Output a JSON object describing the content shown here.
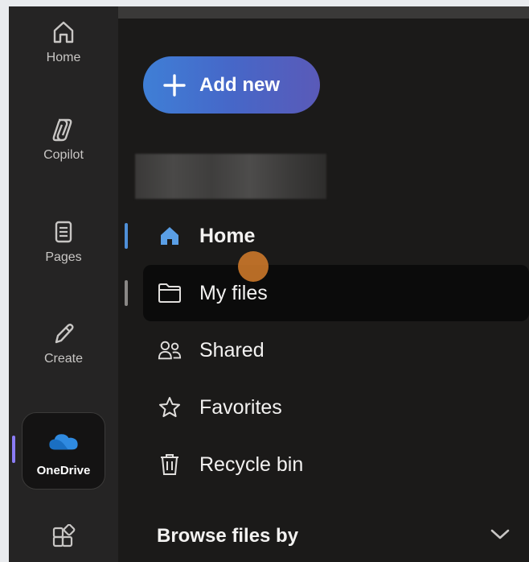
{
  "rail": {
    "items": [
      {
        "label": "Home",
        "icon": "home-icon"
      },
      {
        "label": "Copilot",
        "icon": "copilot-icon"
      },
      {
        "label": "Pages",
        "icon": "pages-icon"
      },
      {
        "label": "Create",
        "icon": "pen-icon"
      },
      {
        "label": "OneDrive",
        "icon": "onedrive-cloud-icon",
        "active": true
      },
      {
        "label": "",
        "icon": "apps-icon"
      }
    ]
  },
  "nav": {
    "add_new_label": "Add new",
    "items": [
      {
        "label": "Home",
        "icon": "home-filled-icon",
        "selected": true
      },
      {
        "label": "My files",
        "icon": "folder-icon",
        "hover": true
      },
      {
        "label": "Shared",
        "icon": "people-icon"
      },
      {
        "label": "Favorites",
        "icon": "star-icon"
      },
      {
        "label": "Recycle bin",
        "icon": "trash-icon"
      }
    ],
    "browse_label": "Browse files by"
  },
  "colors": {
    "rail_bg": "#252424",
    "nav_bg": "#1b1a19",
    "accent_blue": "#4f8fd8",
    "rail_indicator": "#8b7cf6",
    "add_button_gradient": [
      "#3f7fd6",
      "#5a5ab8"
    ],
    "cursor": "#d67e2c"
  }
}
